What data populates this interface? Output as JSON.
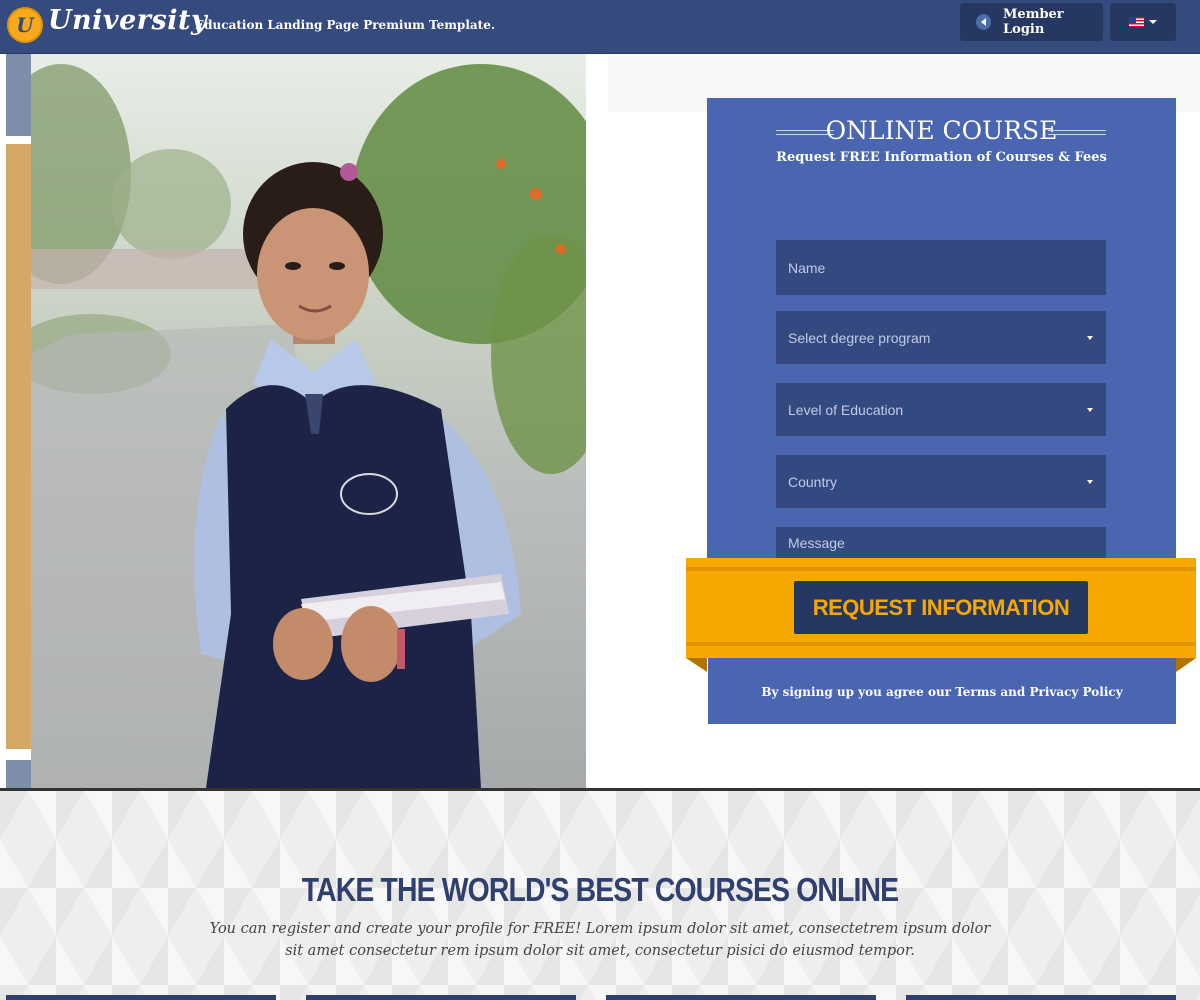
{
  "header": {
    "logo_letter": "U",
    "brand": "University",
    "tagline": "Education Landing Page Premium Template.",
    "login_label": "Member Login",
    "language_flag": "us-flag-icon"
  },
  "form": {
    "title": "ONLINE COURSE",
    "subtitle": "Request FREE Information of Courses & Fees",
    "name_placeholder": "Name",
    "degree_placeholder": "Select degree program",
    "education_placeholder": "Level of Education",
    "country_placeholder": "Country",
    "message_placeholder": "Message",
    "submit_label": "REQUEST INFORMATION",
    "terms_prefix": "By signing up you agree our",
    "terms_link": "Terms",
    "terms_and": "and",
    "privacy_link": "Privacy Policy"
  },
  "section": {
    "title": "TAKE THE WORLD'S BEST COURSES ONLINE",
    "text": "You can register and create your profile for FREE! Lorem ipsum dolor sit amet, consectetrem ipsum dolor sit amet consectetur rem ipsum dolor sit amet, consectetur pisici do eiusmod tempor."
  },
  "colors": {
    "navy": "#354a7d",
    "panel_blue": "#4a66b0",
    "field_blue": "#344980",
    "accent_orange": "#f7a800",
    "button_navy": "#263862"
  }
}
